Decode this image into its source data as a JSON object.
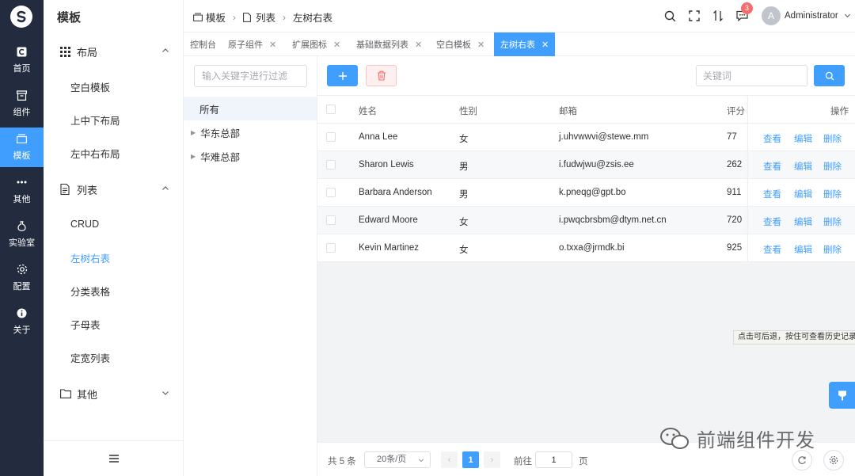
{
  "rail": {
    "items": [
      {
        "label": "首页",
        "icon": "home-icon"
      },
      {
        "label": "组件",
        "icon": "component-icon"
      },
      {
        "label": "模板",
        "icon": "template-icon"
      },
      {
        "label": "其他",
        "icon": "more-icon"
      },
      {
        "label": "实验室",
        "icon": "lab-icon"
      },
      {
        "label": "配置",
        "icon": "gear-icon"
      },
      {
        "label": "关于",
        "icon": "info-icon"
      }
    ],
    "active": "模板"
  },
  "sidebar": {
    "title": "模板",
    "groups": [
      {
        "label": "布局",
        "icon": "grid-icon",
        "items": [
          "空白模板",
          "上中下布局",
          "左中右布局"
        ]
      },
      {
        "label": "列表",
        "icon": "document-icon",
        "items": [
          "CRUD",
          "左树右表",
          "分类表格",
          "子母表",
          "定宽列表"
        ]
      },
      {
        "label": "其他",
        "icon": "folder-icon",
        "items": []
      }
    ],
    "active_item": "左树右表"
  },
  "breadcrumb": [
    "模板",
    "列表",
    "左树右表"
  ],
  "header": {
    "notification_count": "3",
    "avatar_letter": "A",
    "username": "Administrator"
  },
  "tabs": [
    {
      "label": "控制台",
      "closable": false
    },
    {
      "label": "原子组件",
      "closable": true
    },
    {
      "label": "扩展图标",
      "closable": true
    },
    {
      "label": "基础数据列表",
      "closable": true
    },
    {
      "label": "空白模板",
      "closable": true
    },
    {
      "label": "左树右表",
      "closable": true,
      "active": true
    }
  ],
  "tree": {
    "filter_placeholder": "输入关键字进行过滤",
    "root": "所有",
    "nodes": [
      "华东总部",
      "华难总部"
    ]
  },
  "toolbar": {
    "keyword_placeholder": "关键词"
  },
  "table": {
    "columns": [
      "姓名",
      "性别",
      "邮箱",
      "评分",
      "操作"
    ],
    "rows": [
      {
        "name": "Anna Lee",
        "gender": "女",
        "email": "j.uhvwwvi@stewe.mm",
        "score": "77"
      },
      {
        "name": "Sharon Lewis",
        "gender": "男",
        "email": "i.fudwjwu@zsis.ee",
        "score": "262"
      },
      {
        "name": "Barbara Anderson",
        "gender": "男",
        "email": "k.pneqg@gpt.bo",
        "score": "911"
      },
      {
        "name": "Edward Moore",
        "gender": "女",
        "email": "i.pwqcbrsbm@dtym.net.cn",
        "score": "720"
      },
      {
        "name": "Kevin Martinez",
        "gender": "女",
        "email": "o.txxa@jrmdk.bi",
        "score": "925"
      }
    ],
    "actions": [
      "查看",
      "编辑",
      "删除"
    ]
  },
  "tooltip": "点击可后退，按住可查看历史记录",
  "pagination": {
    "total": "共 5 条",
    "page_size": "20条/页",
    "current_page": "1",
    "goto_label": "前往",
    "goto_value": "1",
    "page_unit": "页"
  },
  "watermark": "前端组件开发",
  "colors": {
    "primary": "#409eff",
    "rail_bg": "#232c3e",
    "danger": "#f56c6c"
  }
}
